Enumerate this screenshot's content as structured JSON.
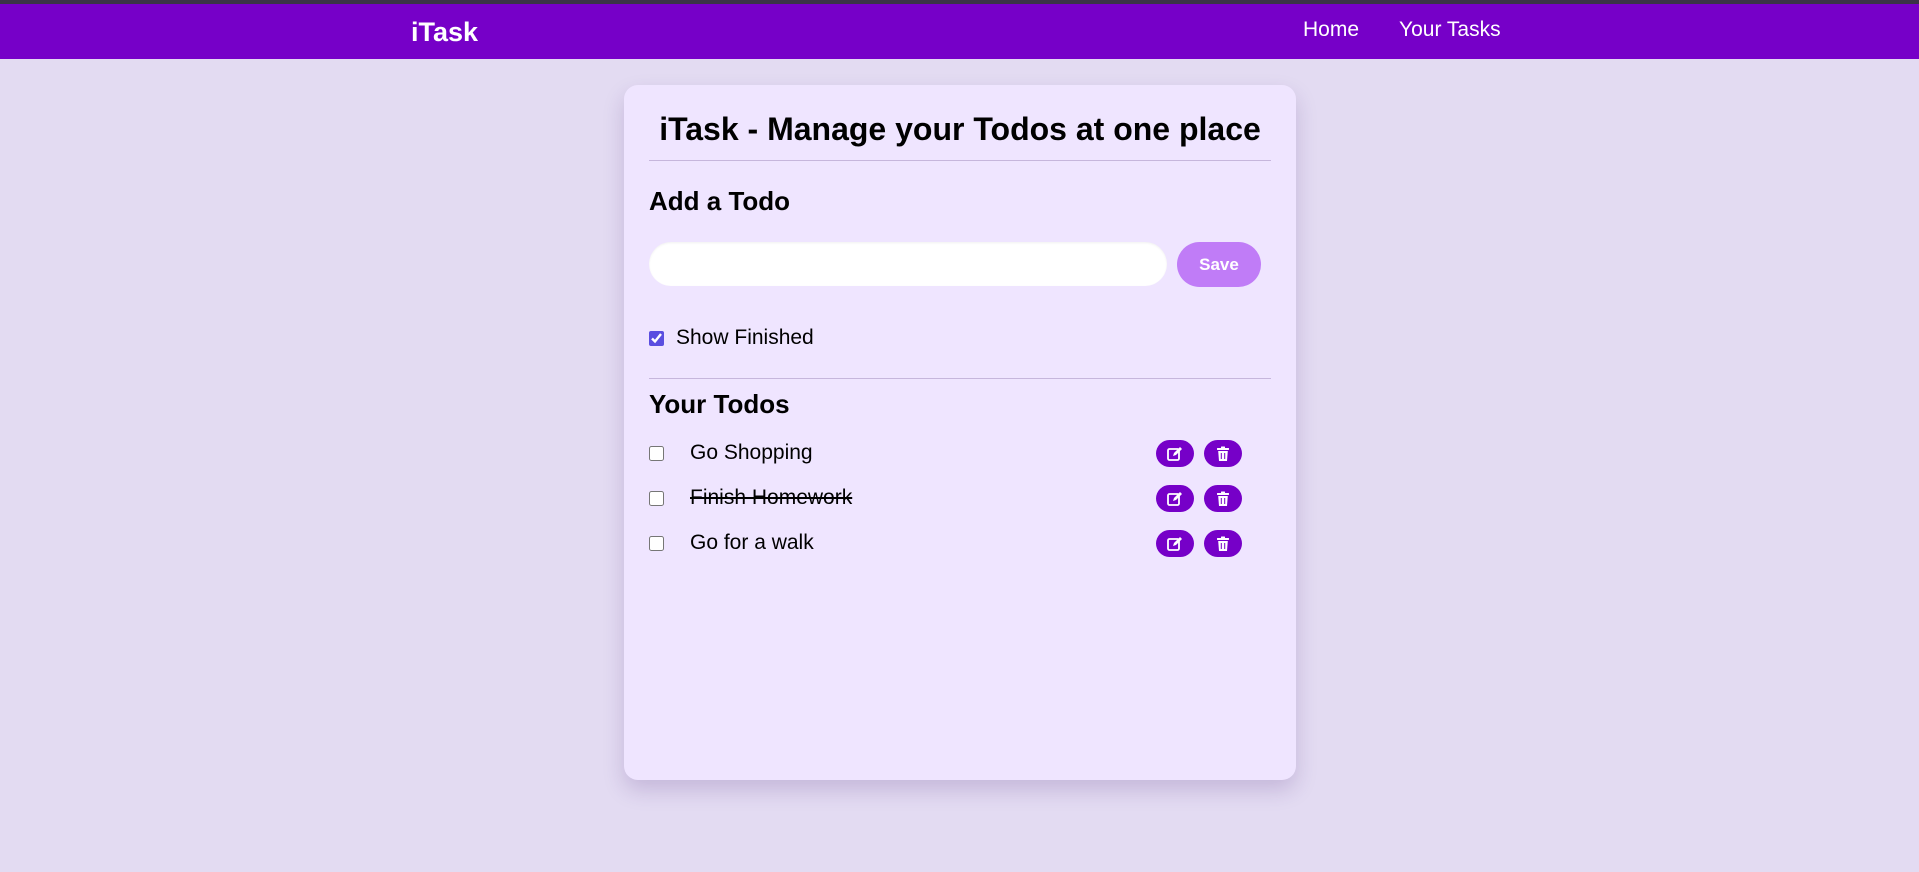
{
  "navbar": {
    "brand": "iTask",
    "links": [
      "Home",
      "Your Tasks"
    ]
  },
  "page": {
    "title": "iTask - Manage your Todos at one place"
  },
  "add_todo": {
    "heading": "Add a Todo",
    "input_value": "",
    "save_label": "Save"
  },
  "filter": {
    "show_finished_label": "Show Finished",
    "show_finished_checked": true
  },
  "todos": {
    "heading": "Your Todos",
    "items": [
      {
        "text": "Go Shopping",
        "completed": false
      },
      {
        "text": "Finish Homework",
        "completed": true
      },
      {
        "text": "Go for a walk",
        "completed": false
      }
    ]
  },
  "icons": {
    "edit": "edit-icon",
    "delete": "trash-icon"
  },
  "colors": {
    "primary": "#7600c8",
    "save_button": "#c07cf7",
    "card_background": "#efe5ff",
    "page_background": "#e3dbf2"
  }
}
